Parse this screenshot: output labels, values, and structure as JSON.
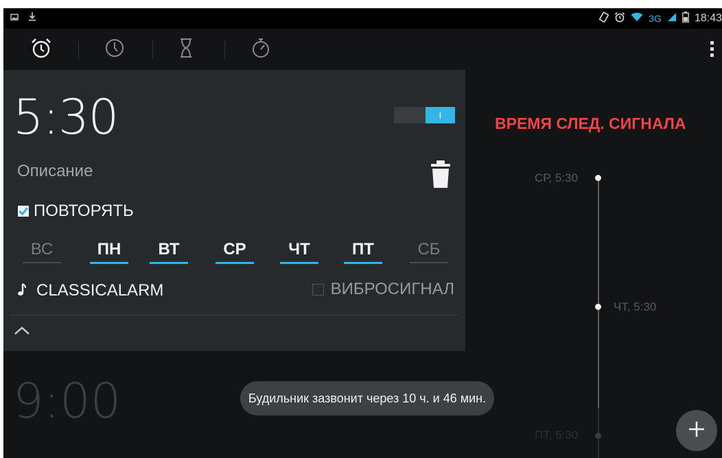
{
  "status_bar": {
    "network": "3G",
    "time": "18:43",
    "left_icons": [
      "image-icon",
      "download-icon"
    ],
    "right_icons": [
      "rotate-icon",
      "alarm-icon",
      "wifi-icon",
      "signal-icon",
      "battery-icon"
    ]
  },
  "tabs": [
    {
      "name": "alarm-tab",
      "icon": "alarm-clock-icon",
      "active": true
    },
    {
      "name": "clock-tab",
      "icon": "clock-icon",
      "active": false
    },
    {
      "name": "timer-tab",
      "icon": "hourglass-icon",
      "active": false
    },
    {
      "name": "stopwatch-tab",
      "icon": "stopwatch-icon",
      "active": false
    }
  ],
  "alarm_expanded": {
    "time": "5:30",
    "enabled": true,
    "switch_label": "I",
    "description_placeholder": "Описание",
    "repeat_label": "ПОВТОРЯТЬ",
    "repeat_checked": true,
    "days": [
      {
        "label": "ВС",
        "on": false
      },
      {
        "label": "ПН",
        "on": true
      },
      {
        "label": "ВТ",
        "on": true
      },
      {
        "label": "СР",
        "on": true
      },
      {
        "label": "ЧТ",
        "on": true
      },
      {
        "label": "ПТ",
        "on": true
      },
      {
        "label": "СБ",
        "on": false
      }
    ],
    "ringtone": "CLASSICALARM",
    "vibrate_label": "ВИБРОСИГНАЛ",
    "vibrate_checked": false
  },
  "alarm_collapsed": {
    "time": "9:00"
  },
  "next_alarms": {
    "title": "ВРЕМЯ СЛЕД. СИГНАЛА",
    "entries": [
      {
        "label": "СР, 5:30"
      },
      {
        "label": "ЧТ, 5:30"
      },
      {
        "label": "ПТ, 5:30"
      }
    ]
  },
  "toast": "Будильник зазвонит через 10 ч. и 46 мин.",
  "colors": {
    "accent": "#33b5e5",
    "title_red": "#ee4444",
    "background": "#121416",
    "card": "#272a2d"
  }
}
